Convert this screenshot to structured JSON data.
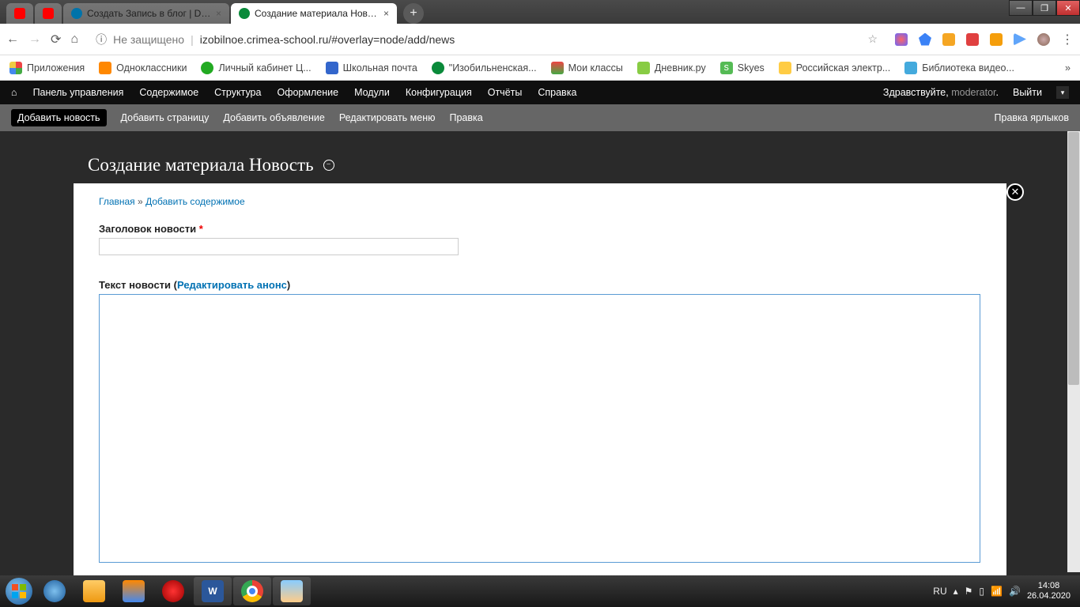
{
  "browser": {
    "tabs": [
      {
        "title": "",
        "fav": "yt"
      },
      {
        "title": "",
        "fav": "yt"
      },
      {
        "title": "Создать Запись в блог | Drupal.",
        "fav": "dr"
      },
      {
        "title": "Создание материала Новость | ",
        "fav": "gr",
        "active": true
      }
    ],
    "not_secure": "Не защищено",
    "url": "izobilnoe.crimea-school.ru/#overlay=node/add/news"
  },
  "bookmarks": [
    {
      "label": "Приложения"
    },
    {
      "label": "Одноклассники"
    },
    {
      "label": "Личный кабинет Ц..."
    },
    {
      "label": "Школьная почта"
    },
    {
      "label": "\"Изобильненская..."
    },
    {
      "label": "Мои классы"
    },
    {
      "label": "Дневник.ру"
    },
    {
      "label": "Skyes"
    },
    {
      "label": "Российская электр..."
    },
    {
      "label": "Библиотека видео..."
    }
  ],
  "admin": {
    "items": [
      "Панель управления",
      "Содержимое",
      "Структура",
      "Оформление",
      "Модули",
      "Конфигурация",
      "Отчёты",
      "Справка"
    ],
    "greeting": "Здравствуйте, ",
    "user": "moderator",
    "logout": "Выйти"
  },
  "shortcuts": {
    "items": [
      "Добавить новость",
      "Добавить страницу",
      "Добавить объявление",
      "Редактировать меню",
      "Правка"
    ],
    "edit": "Правка ярлыков"
  },
  "content": {
    "title": "Создание материала Новость",
    "breadcrumb": {
      "home": "Главная",
      "sep": "»",
      "add": "Добавить содержимое"
    },
    "field_title_label": "Заголовок новости",
    "required": "*",
    "field_body_label": "Текст новости (",
    "edit_summary": "Редактировать анонс",
    "field_body_close": ")"
  },
  "tray": {
    "lang": "RU",
    "time": "14:08",
    "date": "26.04.2020"
  }
}
